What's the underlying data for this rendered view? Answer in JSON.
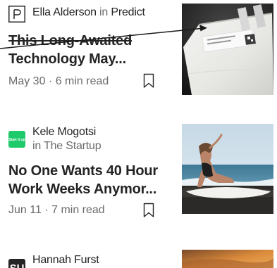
{
  "articles": [
    {
      "author": "Ella Alderson",
      "in_label": "in",
      "publication": "Predict",
      "publication_icon": "predict-logo-icon",
      "title_line1": "This Long-Awaited",
      "title_line2": "Technology May...",
      "date": "May 30",
      "separator": "·",
      "read_time": "6 min read",
      "thumbnail": "battery-cell-image"
    },
    {
      "author": "Kele Mogotsi",
      "in_label": "in The Startup",
      "publication_icon": "the-startup-logo-icon",
      "publication_icon_text": "Start it up",
      "title_line1": "No One Wants 40 Hour",
      "title_line2": "Work Weeks Anymor...",
      "date": "Jun 11",
      "separator": "·",
      "read_time": "7 min read",
      "thumbnail": "surfer-on-beach-image"
    },
    {
      "author": "Hannah Furst",
      "publication_icon": "su-logo-icon",
      "publication_icon_text": "SU",
      "thumbnail": "sunset-image"
    }
  ],
  "colors": {
    "text_primary": "#242424",
    "text_secondary": "#6b6b6b",
    "startup_green": "#1fca6b"
  }
}
